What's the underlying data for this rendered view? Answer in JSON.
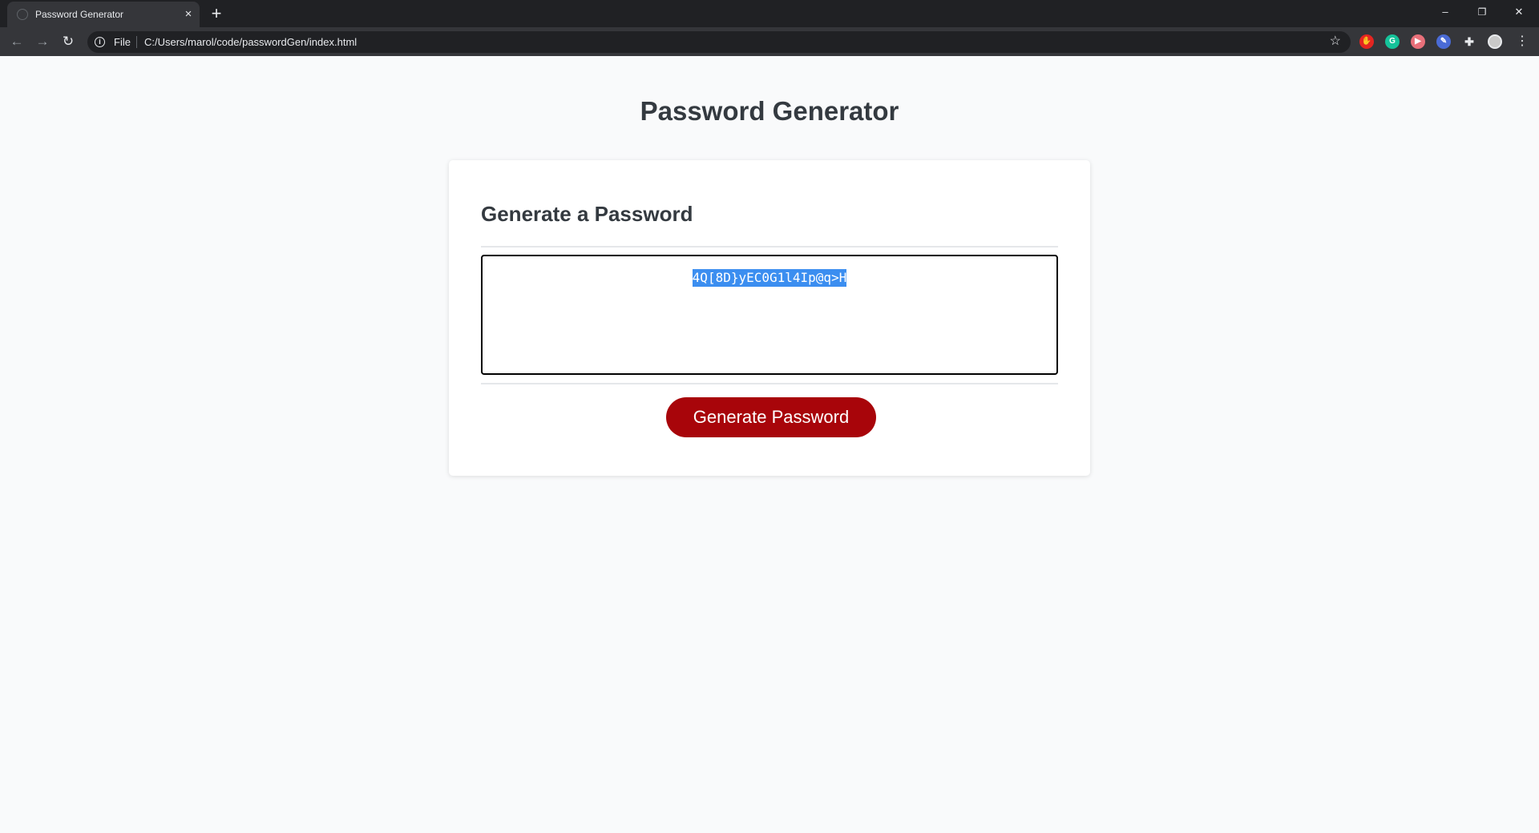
{
  "browser": {
    "tab_title": "Password Generator",
    "tab_close": "×",
    "new_tab": "+",
    "url_scheme_label": "File",
    "url": "C:/Users/marol/code/passwordGen/index.html",
    "window_controls": {
      "minimize": "–",
      "restore": "❐",
      "close": "✕"
    },
    "nav": {
      "back": "←",
      "forward": "→",
      "reload": "↻"
    },
    "star": "☆",
    "menu": "⋮",
    "extensions": [
      {
        "name": "stop-extension-icon",
        "color": "#e52521",
        "glyph": "✋"
      },
      {
        "name": "grammarly-extension-icon",
        "color": "#15c39a",
        "glyph": "G"
      },
      {
        "name": "screencast-extension-icon",
        "color": "#e8707a",
        "glyph": "▶"
      },
      {
        "name": "pen-extension-icon",
        "color": "#4a6bd6",
        "glyph": "✎"
      },
      {
        "name": "puzzle-extensions-icon",
        "color": "#35363a",
        "glyph": "✚"
      }
    ]
  },
  "page": {
    "title": "Password Generator",
    "card_heading": "Generate a Password",
    "password_value": "4Q[8D}yEC0G1l4Ip@q>H",
    "generate_button": "Generate Password"
  },
  "colors": {
    "button": "#a8050a",
    "selection": "#3b8ef0",
    "heading": "#343a40"
  }
}
